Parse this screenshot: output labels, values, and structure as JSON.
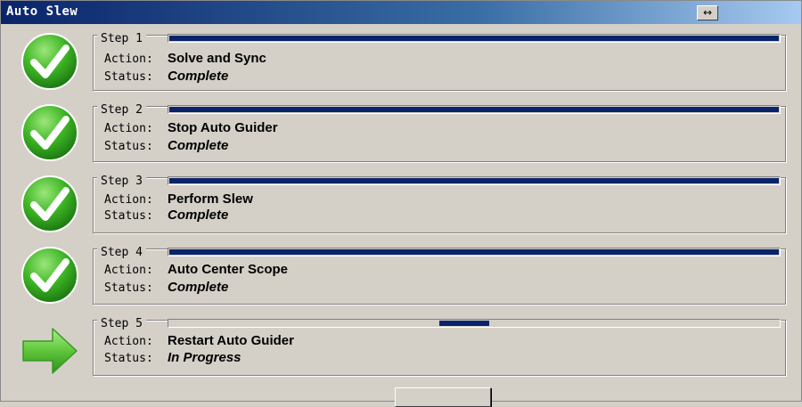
{
  "window": {
    "title": "Auto Slew",
    "resize_button": "↔"
  },
  "labels": {
    "action": "Action:",
    "status": "Status:"
  },
  "steps": [
    {
      "legend": "Step 1",
      "action": "Solve and Sync",
      "status": "Complete",
      "state": "complete",
      "progress": 1.0
    },
    {
      "legend": "Step 2",
      "action": "Stop Auto Guider",
      "status": "Complete",
      "state": "complete",
      "progress": 1.0
    },
    {
      "legend": "Step 3",
      "action": "Perform Slew",
      "status": "Complete",
      "state": "complete",
      "progress": 1.0
    },
    {
      "legend": "Step 4",
      "action": "Auto Center Scope",
      "status": "Complete",
      "state": "complete",
      "progress": 1.0
    },
    {
      "legend": "Step 5",
      "action": "Restart Auto Guider",
      "status": "In Progress",
      "state": "in-progress",
      "progress": "indeterminate"
    }
  ],
  "colors": {
    "progress_fill": "#0a246a",
    "check_green": "#2fa51b",
    "arrow_green": "#5ec63a",
    "titlebar": "#0a246a"
  },
  "icons": {
    "complete": "checkmark-icon",
    "in_progress": "arrow-right-icon"
  },
  "bottom_button": {
    "label": ""
  }
}
